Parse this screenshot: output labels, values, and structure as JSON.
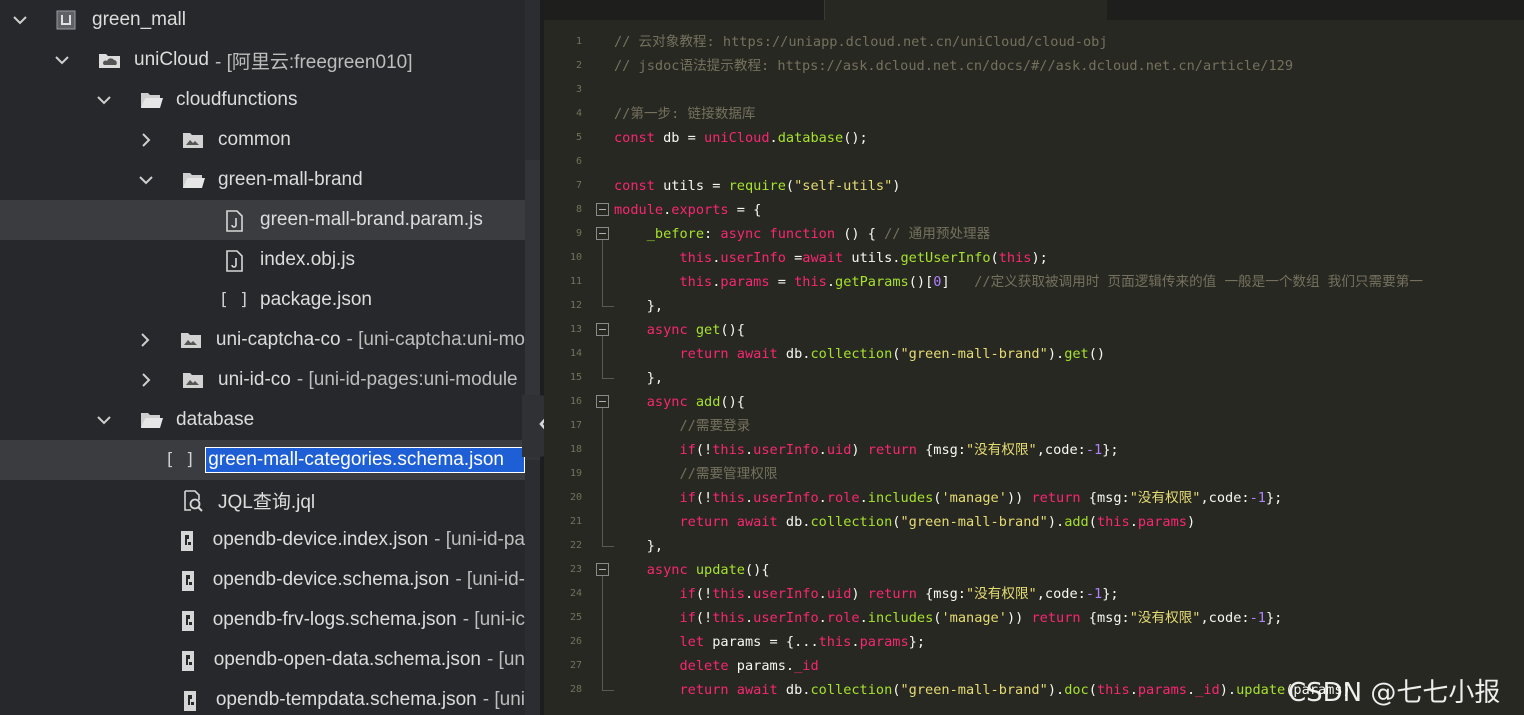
{
  "sidebar": {
    "items": [
      {
        "label": "green_mall",
        "indent": 0,
        "chevron": "down",
        "icon": "project",
        "suffix": ""
      },
      {
        "label": "uniCloud",
        "indent": 1,
        "chevron": "down",
        "icon": "cloud-folder",
        "suffix": "- [阿里云:freegreen010]"
      },
      {
        "label": "cloudfunctions",
        "indent": 2,
        "chevron": "down",
        "icon": "folder-open",
        "suffix": ""
      },
      {
        "label": "common",
        "indent": 3,
        "chevron": "right",
        "icon": "folder",
        "suffix": ""
      },
      {
        "label": "green-mall-brand",
        "indent": 3,
        "chevron": "down",
        "icon": "folder-open",
        "suffix": ""
      },
      {
        "label": "green-mall-brand.param.js",
        "indent": 4,
        "chevron": "none",
        "icon": "js-file",
        "suffix": "",
        "highlight": true
      },
      {
        "label": "index.obj.js",
        "indent": 4,
        "chevron": "none",
        "icon": "js-file",
        "suffix": ""
      },
      {
        "label": "package.json",
        "indent": 4,
        "chevron": "none",
        "icon": "json-file",
        "suffix": ""
      },
      {
        "label": "uni-captcha-co",
        "indent": 3,
        "chevron": "right",
        "icon": "folder",
        "suffix": "- [uni-captcha:uni-mo"
      },
      {
        "label": "uni-id-co",
        "indent": 3,
        "chevron": "right",
        "icon": "folder",
        "suffix": "- [uni-id-pages:uni-module"
      },
      {
        "label": "database",
        "indent": 2,
        "chevron": "down",
        "icon": "folder-open",
        "suffix": ""
      },
      {
        "label": "green-mall-categories.schema.json",
        "indent": 3,
        "chevron": "none",
        "icon": "json-file",
        "suffix": "",
        "highlight": true,
        "renaming": true
      },
      {
        "label": "JQL查询.jql",
        "indent": 3,
        "chevron": "none",
        "icon": "jql-file",
        "suffix": ""
      },
      {
        "label": "opendb-device.index.json",
        "indent": 3,
        "chevron": "none",
        "icon": "schema-file",
        "suffix": "- [uni-id-pa"
      },
      {
        "label": "opendb-device.schema.json",
        "indent": 3,
        "chevron": "none",
        "icon": "schema-file",
        "suffix": "- [uni-id-"
      },
      {
        "label": "opendb-frv-logs.schema.json",
        "indent": 3,
        "chevron": "none",
        "icon": "schema-file",
        "suffix": "- [uni-ic"
      },
      {
        "label": "opendb-open-data.schema.json",
        "indent": 3,
        "chevron": "none",
        "icon": "schema-file",
        "suffix": "- [un"
      },
      {
        "label": "opendb-tempdata.schema.json",
        "indent": 3,
        "chevron": "none",
        "icon": "schema-file",
        "suffix": "- [uni"
      }
    ]
  },
  "editor": {
    "line_numbers": [
      "1",
      "2",
      "3",
      "4",
      "5",
      "6",
      "7",
      "8",
      "9",
      "10",
      "11",
      "12",
      "13",
      "14",
      "15",
      "16",
      "17",
      "18",
      "19",
      "20",
      "21",
      "22",
      "23",
      "24",
      "25",
      "26",
      "27",
      "28"
    ],
    "fold_lines": [
      8,
      9,
      13,
      16,
      23
    ],
    "lines": [
      [
        [
          "c",
          "// 云对象教程: https://uniapp.dcloud.net.cn/uniCloud/cloud-obj"
        ]
      ],
      [
        [
          "c",
          "// jsdoc语法提示教程: https://ask.dcloud.net.cn/docs/#//ask.dcloud.net.cn/article/129"
        ]
      ],
      [],
      [
        [
          "c",
          "//第一步: 链接数据库"
        ]
      ],
      [
        [
          "k",
          "const"
        ],
        [
          "t",
          " db = "
        ],
        [
          "k",
          "uniCloud"
        ],
        [
          "t",
          "."
        ],
        [
          "f",
          "database"
        ],
        [
          "t",
          "();"
        ]
      ],
      [],
      [
        [
          "k",
          "const"
        ],
        [
          "t",
          " utils = "
        ],
        [
          "f",
          "require"
        ],
        [
          "t",
          "("
        ],
        [
          "s",
          "\"self-utils\""
        ],
        [
          "t",
          ")"
        ]
      ],
      [
        [
          "k",
          "module"
        ],
        [
          "t",
          "."
        ],
        [
          "k",
          "exports"
        ],
        [
          "t",
          " = {"
        ]
      ],
      [
        [
          "t",
          "    "
        ],
        [
          "f",
          "_before"
        ],
        [
          "t",
          ": "
        ],
        [
          "k",
          "async"
        ],
        [
          "t",
          " "
        ],
        [
          "k",
          "function"
        ],
        [
          "t",
          " () { "
        ],
        [
          "c",
          "// 通用预处理器"
        ]
      ],
      [
        [
          "t",
          "        "
        ],
        [
          "k",
          "this"
        ],
        [
          "t",
          "."
        ],
        [
          "k",
          "userInfo"
        ],
        [
          "t",
          " ="
        ],
        [
          "k",
          "await"
        ],
        [
          "t",
          " utils."
        ],
        [
          "f",
          "getUserInfo"
        ],
        [
          "t",
          "("
        ],
        [
          "k",
          "this"
        ],
        [
          "t",
          ");"
        ]
      ],
      [
        [
          "t",
          "        "
        ],
        [
          "k",
          "this"
        ],
        [
          "t",
          "."
        ],
        [
          "k",
          "params"
        ],
        [
          "t",
          " = "
        ],
        [
          "k",
          "this"
        ],
        [
          "t",
          "."
        ],
        [
          "f",
          "getParams"
        ],
        [
          "t",
          "()["
        ],
        [
          "n",
          "0"
        ],
        [
          "t",
          "]   "
        ],
        [
          "c",
          "//定义获取被调用时 页面逻辑传来的值 一般是一个数组 我们只需要第一"
        ]
      ],
      [
        [
          "t",
          "    },"
        ]
      ],
      [
        [
          "t",
          "    "
        ],
        [
          "k",
          "async"
        ],
        [
          "t",
          " "
        ],
        [
          "f",
          "get"
        ],
        [
          "t",
          "(){"
        ]
      ],
      [
        [
          "t",
          "        "
        ],
        [
          "k",
          "return"
        ],
        [
          "t",
          " "
        ],
        [
          "k",
          "await"
        ],
        [
          "t",
          " db."
        ],
        [
          "f",
          "collection"
        ],
        [
          "t",
          "("
        ],
        [
          "s",
          "\"green-mall-brand\""
        ],
        [
          "t",
          ")."
        ],
        [
          "f",
          "get"
        ],
        [
          "t",
          "()"
        ]
      ],
      [
        [
          "t",
          "    },"
        ]
      ],
      [
        [
          "t",
          "    "
        ],
        [
          "k",
          "async"
        ],
        [
          "t",
          " "
        ],
        [
          "f",
          "add"
        ],
        [
          "t",
          "(){"
        ]
      ],
      [
        [
          "t",
          "        "
        ],
        [
          "c",
          "//需要登录"
        ]
      ],
      [
        [
          "t",
          "        "
        ],
        [
          "k",
          "if"
        ],
        [
          "t",
          "(!"
        ],
        [
          "k",
          "this"
        ],
        [
          "t",
          "."
        ],
        [
          "k",
          "userInfo"
        ],
        [
          "t",
          "."
        ],
        [
          "k",
          "uid"
        ],
        [
          "t",
          ") "
        ],
        [
          "k",
          "return"
        ],
        [
          "t",
          " {msg:"
        ],
        [
          "s",
          "\"没有权限\""
        ],
        [
          "t",
          ",code:"
        ],
        [
          "n",
          "-1"
        ],
        [
          "t",
          "};"
        ]
      ],
      [
        [
          "t",
          "        "
        ],
        [
          "c",
          "//需要管理权限"
        ]
      ],
      [
        [
          "t",
          "        "
        ],
        [
          "k",
          "if"
        ],
        [
          "t",
          "(!"
        ],
        [
          "k",
          "this"
        ],
        [
          "t",
          "."
        ],
        [
          "k",
          "userInfo"
        ],
        [
          "t",
          "."
        ],
        [
          "k",
          "role"
        ],
        [
          "t",
          "."
        ],
        [
          "f",
          "includes"
        ],
        [
          "t",
          "("
        ],
        [
          "s",
          "'manage'"
        ],
        [
          "t",
          ")) "
        ],
        [
          "k",
          "return"
        ],
        [
          "t",
          " {msg:"
        ],
        [
          "s",
          "\"没有权限\""
        ],
        [
          "t",
          ",code:"
        ],
        [
          "n",
          "-1"
        ],
        [
          "t",
          "};"
        ]
      ],
      [
        [
          "t",
          "        "
        ],
        [
          "k",
          "return"
        ],
        [
          "t",
          " "
        ],
        [
          "k",
          "await"
        ],
        [
          "t",
          " db."
        ],
        [
          "f",
          "collection"
        ],
        [
          "t",
          "("
        ],
        [
          "s",
          "\"green-mall-brand\""
        ],
        [
          "t",
          ")."
        ],
        [
          "f",
          "add"
        ],
        [
          "t",
          "("
        ],
        [
          "k",
          "this"
        ],
        [
          "t",
          "."
        ],
        [
          "k",
          "params"
        ],
        [
          "t",
          ")"
        ]
      ],
      [
        [
          "t",
          "    },"
        ]
      ],
      [
        [
          "t",
          "    "
        ],
        [
          "k",
          "async"
        ],
        [
          "t",
          " "
        ],
        [
          "f",
          "update"
        ],
        [
          "t",
          "(){"
        ]
      ],
      [
        [
          "t",
          "        "
        ],
        [
          "k",
          "if"
        ],
        [
          "t",
          "(!"
        ],
        [
          "k",
          "this"
        ],
        [
          "t",
          "."
        ],
        [
          "k",
          "userInfo"
        ],
        [
          "t",
          "."
        ],
        [
          "k",
          "uid"
        ],
        [
          "t",
          ") "
        ],
        [
          "k",
          "return"
        ],
        [
          "t",
          " {msg:"
        ],
        [
          "s",
          "\"没有权限\""
        ],
        [
          "t",
          ",code:"
        ],
        [
          "n",
          "-1"
        ],
        [
          "t",
          "};"
        ]
      ],
      [
        [
          "t",
          "        "
        ],
        [
          "k",
          "if"
        ],
        [
          "t",
          "(!"
        ],
        [
          "k",
          "this"
        ],
        [
          "t",
          "."
        ],
        [
          "k",
          "userInfo"
        ],
        [
          "t",
          "."
        ],
        [
          "k",
          "role"
        ],
        [
          "t",
          "."
        ],
        [
          "f",
          "includes"
        ],
        [
          "t",
          "("
        ],
        [
          "s",
          "'manage'"
        ],
        [
          "t",
          ")) "
        ],
        [
          "k",
          "return"
        ],
        [
          "t",
          " {msg:"
        ],
        [
          "s",
          "\"没有权限\""
        ],
        [
          "t",
          ",code:"
        ],
        [
          "n",
          "-1"
        ],
        [
          "t",
          "};"
        ]
      ],
      [
        [
          "t",
          "        "
        ],
        [
          "k",
          "let"
        ],
        [
          "t",
          " params = {..."
        ],
        [
          "k",
          "this"
        ],
        [
          "t",
          "."
        ],
        [
          "k",
          "params"
        ],
        [
          "t",
          "};"
        ]
      ],
      [
        [
          "t",
          "        "
        ],
        [
          "k",
          "delete"
        ],
        [
          "t",
          " params."
        ],
        [
          "k",
          "_id"
        ]
      ],
      [
        [
          "t",
          "        "
        ],
        [
          "k",
          "return"
        ],
        [
          "t",
          " "
        ],
        [
          "k",
          "await"
        ],
        [
          "t",
          " db."
        ],
        [
          "f",
          "collection"
        ],
        [
          "t",
          "("
        ],
        [
          "s",
          "\"green-mall-brand\""
        ],
        [
          "t",
          ")."
        ],
        [
          "f",
          "doc"
        ],
        [
          "t",
          "("
        ],
        [
          "k",
          "this"
        ],
        [
          "t",
          "."
        ],
        [
          "k",
          "params"
        ],
        [
          "t",
          "."
        ],
        [
          "k",
          "_id"
        ],
        [
          "t",
          ")."
        ],
        [
          "f",
          "update"
        ],
        [
          "t",
          "(params)"
        ]
      ]
    ]
  },
  "watermark": {
    "text": "CSDN @七七小报"
  }
}
